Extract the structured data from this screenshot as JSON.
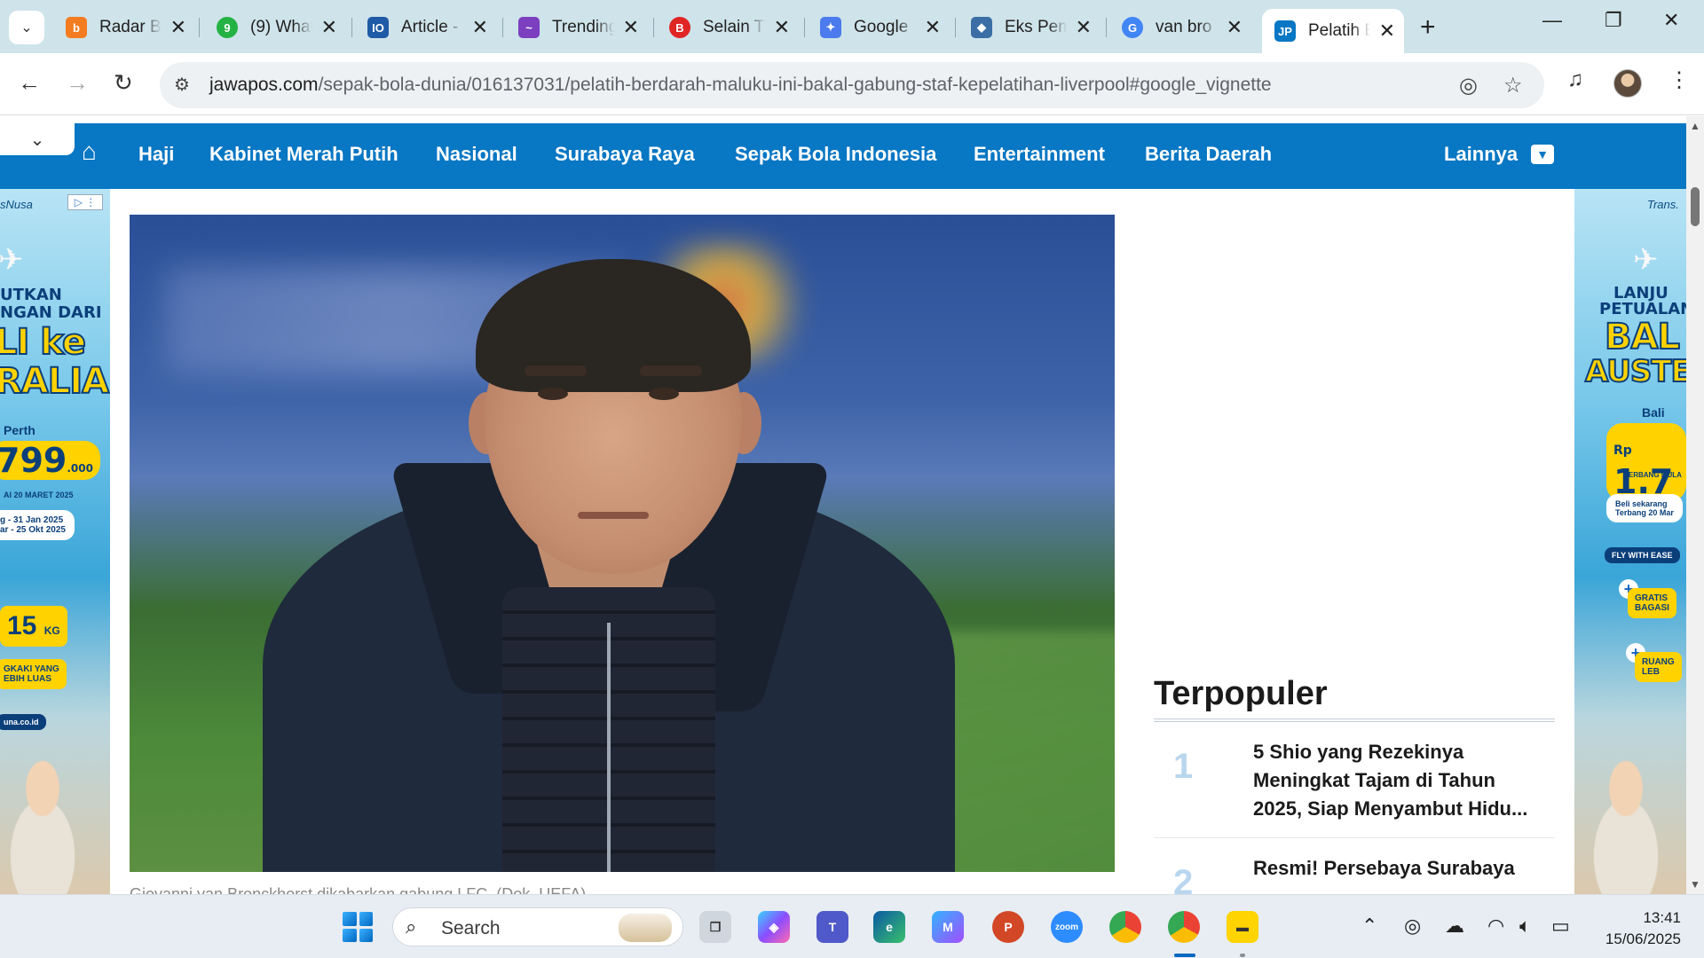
{
  "browser": {
    "tabs": [
      {
        "title": "Radar B",
        "favicon_label": "b",
        "favicon_color": "#f47c20"
      },
      {
        "title": "(9) What",
        "favicon_label": "9",
        "favicon_color": "#25b244"
      },
      {
        "title": "Article -",
        "favicon_label": "IO",
        "favicon_color": "#1f5aa6"
      },
      {
        "title": "Trending",
        "favicon_label": "~",
        "favicon_color": "#7b3fbf"
      },
      {
        "title": "Selain T",
        "favicon_label": "B",
        "favicon_color": "#e02525"
      },
      {
        "title": "Google",
        "favicon_label": "✦",
        "favicon_color": "#4b7bec"
      },
      {
        "title": "Eks Pem",
        "favicon_label": "◆",
        "favicon_color": "#3a6ea5"
      },
      {
        "title": "van bro",
        "favicon_label": "G",
        "favicon_color": "#4285f4"
      },
      {
        "title": "Pelatih B",
        "favicon_label": "JP",
        "favicon_color": "#0877c4"
      }
    ],
    "url_domain": "jawapos.com",
    "url_path": "/sepak-bola-dunia/016137031/pelatih-berdarah-maluku-ini-bakal-gabung-staf-kepelatihan-liverpool#google_vignette"
  },
  "site": {
    "nav": [
      "Haji",
      "Kabinet Merah Putih",
      "Nasional",
      "Surabaya Raya",
      "Sepak Bola Indonesia",
      "Entertainment",
      "Berita Daerah"
    ],
    "more_label": "Lainnya",
    "accent_color": "#0877c4"
  },
  "ads": {
    "left": {
      "brand": "sNusa",
      "headline_1": "UTKAN",
      "headline_2": "NGAN DARI",
      "headline_3": "LI ke",
      "headline_4": "RALIA",
      "city": "Perth",
      "price": "799",
      "price_suffix": ".000",
      "period": "AI 20 MARET 2025",
      "dates_1": "g - 31 Jan 2025",
      "dates_2": "ar - 25 Okt 2025",
      "baggage": "15",
      "baggage_unit": "KG",
      "legroom_1": "GKAKI YANG",
      "legroom_2": "EBIH LUAS",
      "site": "una.co.id"
    },
    "right": {
      "brand": "Trans.",
      "headline_1": "LANJU",
      "headline_2": "PETUALAN",
      "headline_3": "BAL",
      "headline_4": "AUSTE",
      "city": "Bali",
      "currency": "Rp",
      "price": "1.7",
      "note_1": "TERBANG MULA",
      "buy_1": "Beli sekarang",
      "buy_2": "Terbang 20 Mar",
      "tagline": "FLY WITH EASE",
      "perk_1": "GRATIS",
      "perk_1b": "BAGASI",
      "perk_2": "RUANG",
      "perk_2b": "LEB"
    }
  },
  "article": {
    "caption": "Giovanni van Bronckhorst dikabarkan gabung LFC. (Dok. UEFA)"
  },
  "sidebar": {
    "title": "Terpopuler",
    "items": [
      {
        "rank": "1",
        "headline": "5 Shio yang Rezekinya Meningkat Tajam di Tahun 2025, Siap Menyambut Hidu..."
      },
      {
        "rank": "2",
        "headline": "Resmi! Persebaya Surabaya"
      }
    ]
  },
  "taskbar": {
    "search_label": "Search",
    "time": "13:41",
    "date": "15/06/2025"
  }
}
